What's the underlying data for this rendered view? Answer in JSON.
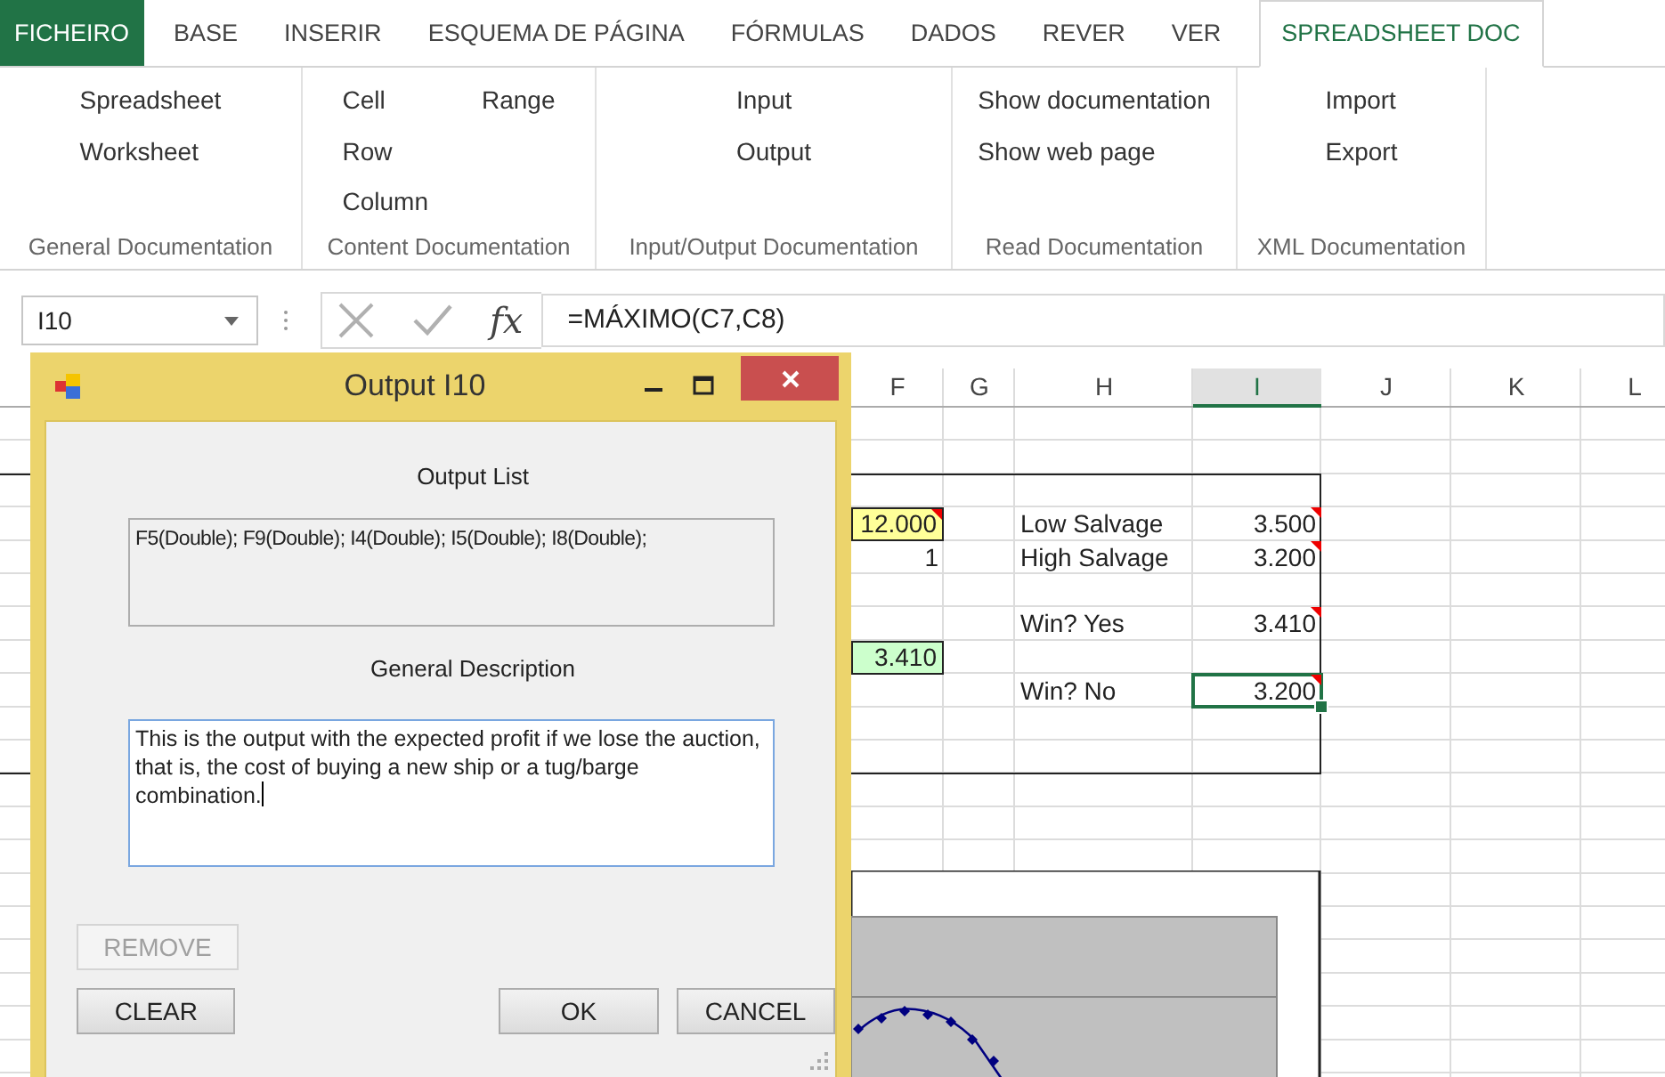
{
  "ribbon": {
    "tabs": [
      {
        "label": "FICHEIRO",
        "kind": "file",
        "selected": false
      },
      {
        "label": "BASE",
        "kind": "tab",
        "selected": false
      },
      {
        "label": "INSERIR",
        "kind": "tab",
        "selected": false
      },
      {
        "label": "ESQUEMA DE PÁGINA",
        "kind": "tab",
        "selected": false
      },
      {
        "label": "FÓRMULAS",
        "kind": "tab",
        "selected": false
      },
      {
        "label": "DADOS",
        "kind": "tab",
        "selected": false
      },
      {
        "label": "REVER",
        "kind": "tab",
        "selected": false
      },
      {
        "label": "VER",
        "kind": "tab",
        "selected": false
      },
      {
        "label": "SPREADSHEET DOC",
        "kind": "tab",
        "selected": true
      }
    ],
    "groups": [
      {
        "title": "General Documentation",
        "columns": [
          [
            "Spreadsheet",
            "Worksheet"
          ]
        ]
      },
      {
        "title": "Content Documentation",
        "columns": [
          [
            "Cell",
            "Row",
            "Column"
          ],
          [
            "Range"
          ]
        ]
      },
      {
        "title": "Input/Output Documentation",
        "columns": [
          [
            "Input",
            "Output"
          ]
        ]
      },
      {
        "title": "Read Documentation",
        "columns": [
          [
            "Show documentation",
            "Show web page"
          ]
        ]
      },
      {
        "title": "XML Documentation",
        "columns": [
          [
            "Import",
            "Export"
          ]
        ]
      }
    ]
  },
  "formula_bar": {
    "name_box": "I10",
    "function_label": "fx",
    "formula": "=MÁXIMO(C7,C8)"
  },
  "sheet": {
    "columns": [
      {
        "label": "F",
        "selected": false
      },
      {
        "label": "G",
        "selected": false
      },
      {
        "label": "H",
        "selected": false
      },
      {
        "label": "I",
        "selected": true
      },
      {
        "label": "J",
        "selected": false
      },
      {
        "label": "K",
        "selected": false
      },
      {
        "label": "L",
        "selected": false
      }
    ],
    "cells": [
      {
        "text": "12.000",
        "kind": "input",
        "comment": true,
        "selected": false
      },
      {
        "text": "Low Salvage",
        "kind": "label",
        "comment": false,
        "selected": false
      },
      {
        "text": "3.500",
        "kind": "number",
        "comment": true,
        "selected": false
      },
      {
        "text": "1",
        "kind": "number",
        "comment": false,
        "selected": false
      },
      {
        "text": "High Salvage",
        "kind": "label",
        "comment": false,
        "selected": false
      },
      {
        "text": "3.200",
        "kind": "number",
        "comment": true,
        "selected": false
      },
      {
        "text": "Win? Yes",
        "kind": "label",
        "comment": false,
        "selected": false
      },
      {
        "text": "3.410",
        "kind": "number",
        "comment": true,
        "selected": false
      },
      {
        "text": "3.410",
        "kind": "result",
        "comment": false,
        "selected": false
      },
      {
        "text": "Win? No",
        "kind": "label",
        "comment": false,
        "selected": false
      },
      {
        "text": "3.200",
        "kind": "number",
        "comment": true,
        "selected": true
      }
    ]
  },
  "dialog": {
    "title": "Output I10",
    "output_list_label": "Output List",
    "output_list": "F5(Double); F9(Double); I4(Double); I5(Double); I8(Double);",
    "description_label": "General Description",
    "description": "This is the output with the expected profit if we lose the auction, that is, the cost of buying a new ship or a tug/barge combination.",
    "buttons": [
      {
        "label": "REMOVE",
        "disabled": true
      },
      {
        "label": "CLEAR",
        "disabled": false
      },
      {
        "label": "OK",
        "disabled": false
      },
      {
        "label": "CANCEL",
        "disabled": false
      }
    ]
  }
}
